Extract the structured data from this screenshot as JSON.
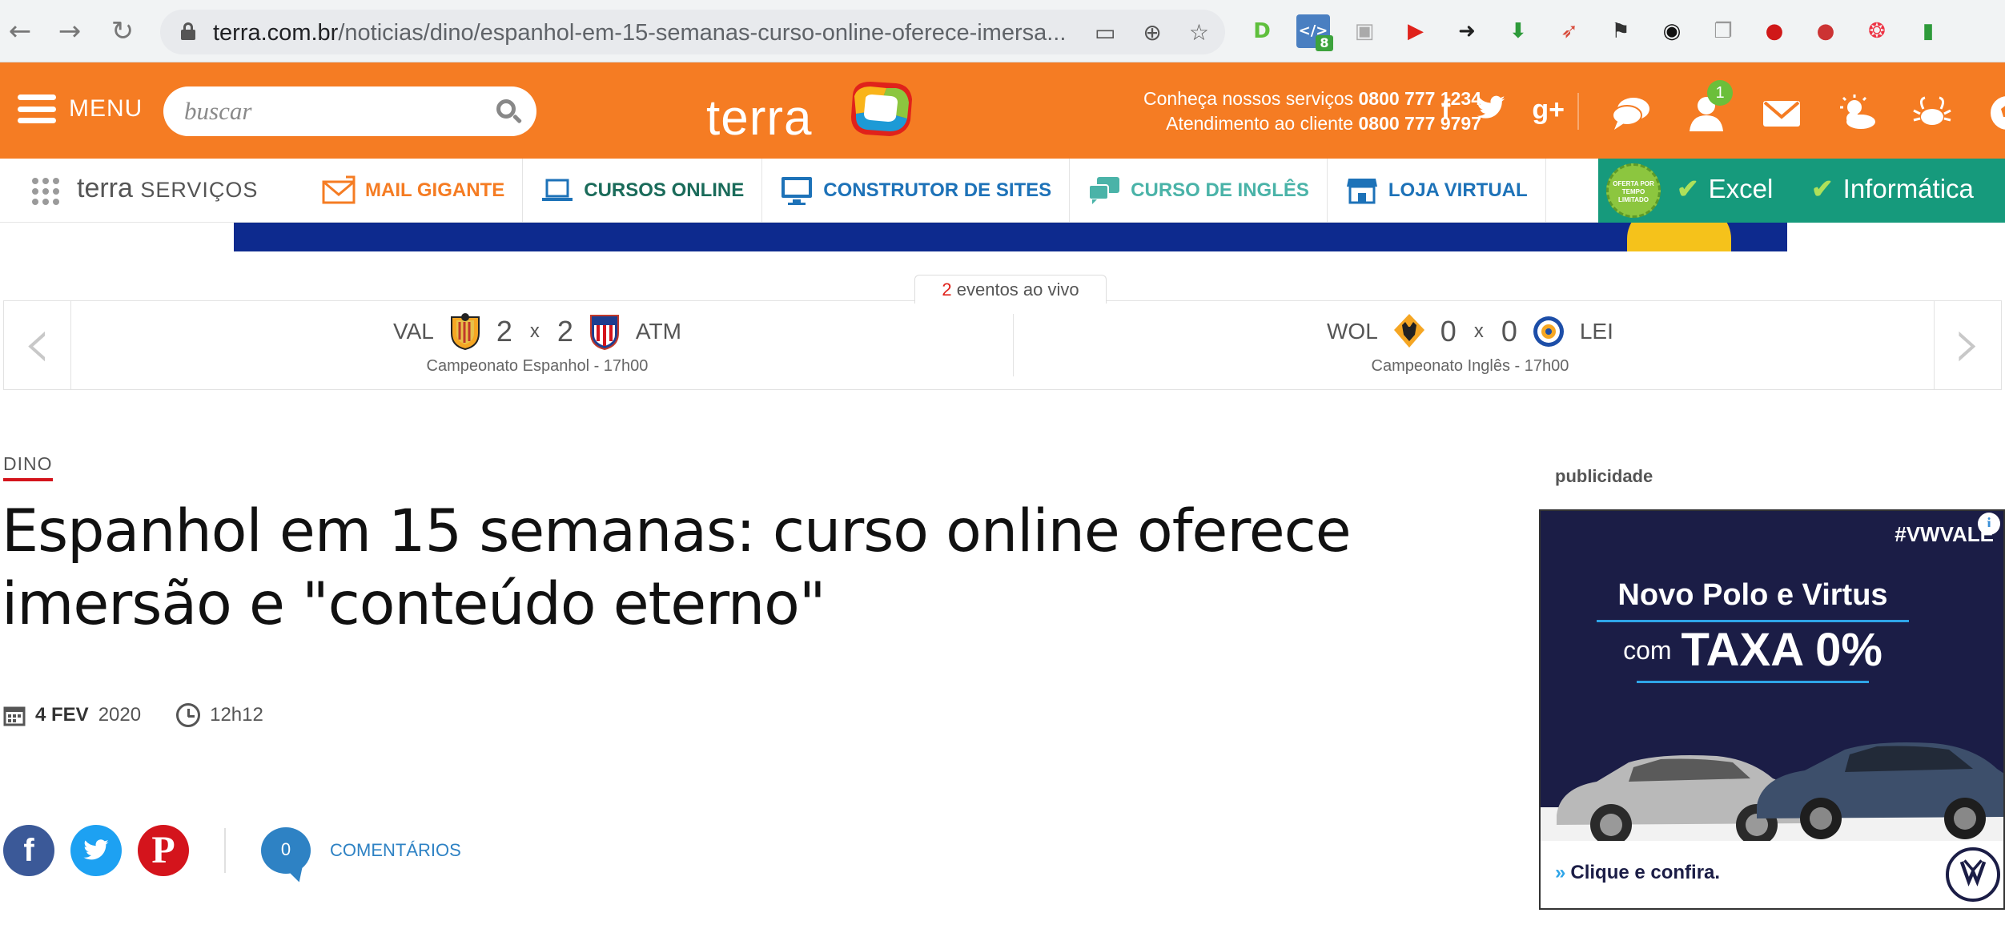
{
  "browser": {
    "url_domain": "terra.com.br",
    "url_path": "/noticias/dino/espanhol-em-15-semanas-curso-online-oferece-imersa...",
    "extension_badge": "8"
  },
  "header": {
    "menu_label": "MENU",
    "search_placeholder": "buscar",
    "logo_text": "terra",
    "contact_line1_label": "Conheça nossos serviços",
    "contact_line1_phone": "0800 777 1234",
    "contact_line2_label": "Atendimento ao cliente",
    "contact_line2_phone": "0800 777 9797",
    "social": [
      "f",
      "g+"
    ],
    "notification_count": "1",
    "colors": {
      "brand_orange": "#f57c23"
    }
  },
  "services": {
    "brand_main": "terra",
    "brand_sub": "SERVIÇOS",
    "items": [
      {
        "label": "MAIL GIGANTE",
        "color": "#f57c23"
      },
      {
        "label": "CURSOS ONLINE",
        "color": "#1a6b5a"
      },
      {
        "label": "CONSTRUTOR DE SITES",
        "color": "#1d72b8"
      },
      {
        "label": "CURSO DE INGLÊS",
        "color": "#4ab3a8"
      },
      {
        "label": "LOJA VIRTUAL",
        "color": "#1d72b8"
      }
    ],
    "promo": {
      "seal_text": "OFERTA POR TEMPO LIMITADO",
      "items": [
        "Excel",
        "Informática"
      ]
    }
  },
  "live": {
    "count": "2",
    "label": "eventos ao vivo",
    "matches": [
      {
        "home": "VAL",
        "home_score": "2",
        "sep": "x",
        "away_score": "2",
        "away": "ATM",
        "info": "Campeonato Espanhol - 17h00"
      },
      {
        "home": "WOL",
        "home_score": "0",
        "sep": "x",
        "away_score": "0",
        "away": "LEI",
        "info": "Campeonato Inglês - 17h00"
      }
    ]
  },
  "article": {
    "category": "DINO",
    "headline": "Espanhol em 15 semanas: curso online oferece imersão e \"conteúdo eterno\"",
    "date_day": "4 FEV",
    "date_year": "2020",
    "time": "12h12",
    "share": {
      "facebook": "f",
      "pinterest": "P"
    },
    "comments_count": "0",
    "comments_label": "COMENTÁRIOS"
  },
  "ad": {
    "label": "publicidade",
    "hashtag": "#VWVALE",
    "info": "i",
    "line1": "Novo Polo e Virtus",
    "line2_small": "com",
    "line2_big": "TAXA 0%",
    "cta": "Clique e confira."
  }
}
